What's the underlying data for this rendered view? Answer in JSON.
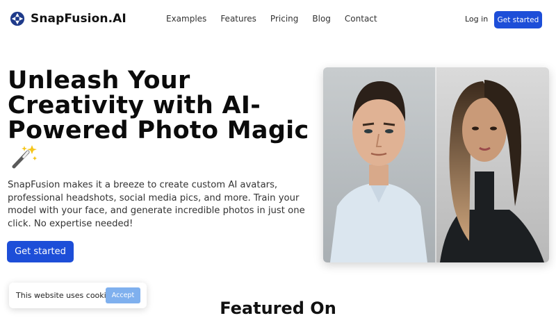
{
  "nav": {
    "brand": "SnapFusion.AI",
    "brand_icon": "aperture-logo-icon",
    "links": [
      "Examples",
      "Features",
      "Pricing",
      "Blog",
      "Contact"
    ],
    "login": "Log in",
    "cta": "Get started"
  },
  "hero": {
    "title": "Unleash Your Creativity with AI-Powered Photo Magic",
    "title_icon": "magic-wand-icon",
    "description": "SnapFusion makes it a breeze to create custom AI avatars, professional headshots, social media pics, and more. Train your model with your face, and generate incredible photos in just one click. No expertise needed!",
    "cta": "Get started",
    "image": "ai-portrait-examples-man-and-woman"
  },
  "cookie_banner": {
    "text": "This website uses cookies",
    "accept": "Accept"
  },
  "featured": {
    "heading": "Featured On"
  },
  "colors": {
    "primary": "#1d4ed8",
    "accept_button": "#7fb0ee",
    "text": "#111111"
  }
}
